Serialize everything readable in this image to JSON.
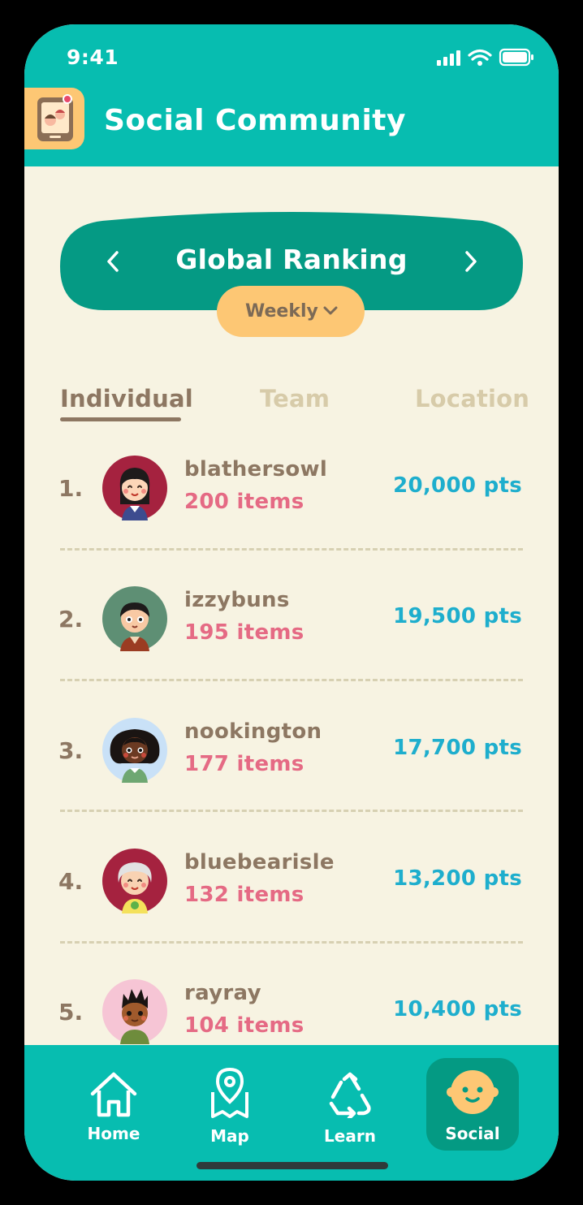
{
  "status": {
    "time": "9:41"
  },
  "app": {
    "title": "Social Community",
    "icon": "phone-people-icon"
  },
  "ranking": {
    "title": "Global Ranking",
    "period": "Weekly",
    "tabs": [
      "Individual",
      "Team",
      "Location"
    ],
    "active_tab": "Individual"
  },
  "leaderboard": [
    {
      "rank": "1.",
      "username": "blathersowl",
      "items": "200 items",
      "points": "20,000 pts",
      "avatar_bg": "#A5223F"
    },
    {
      "rank": "2.",
      "username": "izzybuns",
      "items": "195 items",
      "points": "19,500 pts",
      "avatar_bg": "#5E8F74"
    },
    {
      "rank": "3.",
      "username": "nookington",
      "items": "177 items",
      "points": "17,700 pts",
      "avatar_bg": "#C9E1F7"
    },
    {
      "rank": "4.",
      "username": "bluebearisle",
      "items": "132 items",
      "points": "13,200 pts",
      "avatar_bg": "#A5223F"
    },
    {
      "rank": "5.",
      "username": "rayray",
      "items": "104 items",
      "points": "10,400 pts",
      "avatar_bg": "#F6C5D5"
    }
  ],
  "nav": {
    "items": [
      {
        "label": "Home",
        "icon": "home-icon"
      },
      {
        "label": "Map",
        "icon": "map-pin-icon"
      },
      {
        "label": "Learn",
        "icon": "recycle-icon"
      },
      {
        "label": "Social",
        "icon": "smiley-face-icon"
      }
    ],
    "active": "Social"
  },
  "colors": {
    "header": "#07BDB0",
    "banner": "#059A84",
    "background": "#F7F3E2",
    "accent_yellow": "#FDC774",
    "items_pink": "#E56A84",
    "points_blue": "#1EAECD",
    "text_brown": "#8D7762"
  }
}
